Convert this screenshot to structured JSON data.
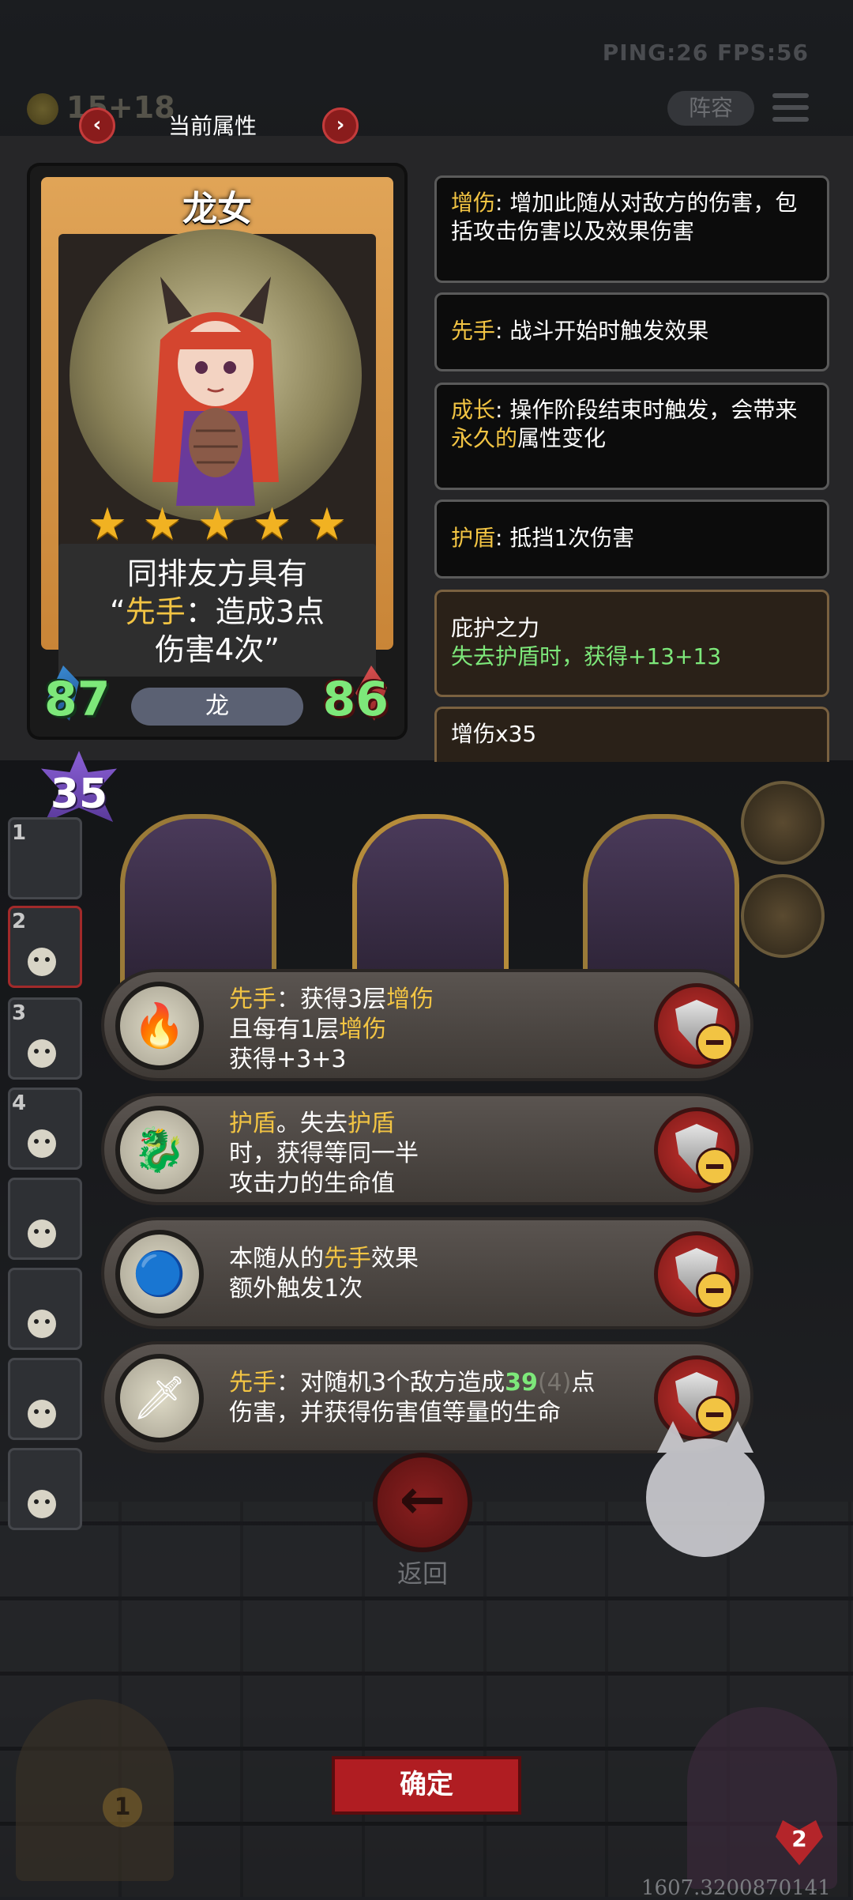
{
  "hud": {
    "ping_fps": "PING:26   FPS:56",
    "gold": "15+18",
    "lineup_label": "阵容"
  },
  "panel": {
    "title": "当前属性",
    "prev_icon": "‹",
    "next_icon": "›"
  },
  "card": {
    "name": "龙女",
    "stars": 5,
    "desc_line1": "同排友方具有",
    "desc_line2_open": "“",
    "desc_line2_kw": "先手",
    "desc_line2_rest": "：造成3点",
    "desc_line3": "伤害4次”",
    "tribe": "龙",
    "attack": "87",
    "health": "86"
  },
  "keywords": [
    {
      "term": "增伤",
      "text": ": 增加此随从对敌方的伤害，包括攻击伤害以及效果伤害"
    },
    {
      "term": "先手",
      "text": ": 战斗开始时触发效果"
    },
    {
      "term": "成长",
      "text": ": 操作阶段结束时触发，会带来",
      "highlight": "永久的",
      "tail": "属性变化"
    },
    {
      "term": "护盾",
      "text": ": 抵挡1次伤害"
    },
    {
      "title": "庇护之力",
      "body": "失去护盾时，获得+13+13"
    },
    {
      "title": "增伤x35"
    }
  ],
  "level": "35",
  "slots": [
    "1",
    "2",
    "3",
    "4",
    "",
    "",
    "",
    ""
  ],
  "abilities": [
    {
      "icon": "torch-staff-icon",
      "line1_kw": "先手",
      "line1_rest": "：获得3层",
      "line1_kw2": "增伤",
      "line2_pre": "且每有1层",
      "line2_kw": "增伤",
      "line3": "获得+3+3"
    },
    {
      "icon": "dragon-crest-icon",
      "line1_kw": "护盾",
      "line1_rest": "。失去",
      "line1_kw2": "护盾",
      "line2": "时，获得等同一半",
      "line3": "攻击力的生命值"
    },
    {
      "icon": "blue-orb-icon",
      "line1_pre": "本随从的",
      "line1_kw": "先手",
      "line1_rest": "效果",
      "line2": "额外触发1次"
    },
    {
      "icon": "purple-blade-icon",
      "line1_kw": "先手",
      "line1_rest": "：对随机3个敌方造成",
      "line1_num": "39",
      "line1_paren": "(4)",
      "line1_tail": "点",
      "line2": "伤害，并获得伤害值等量的生命"
    }
  ],
  "back_label": "返回",
  "confirm_label": "确定",
  "left_counter": "1",
  "right_counter": "2",
  "debug_value": "1607.3200870141"
}
